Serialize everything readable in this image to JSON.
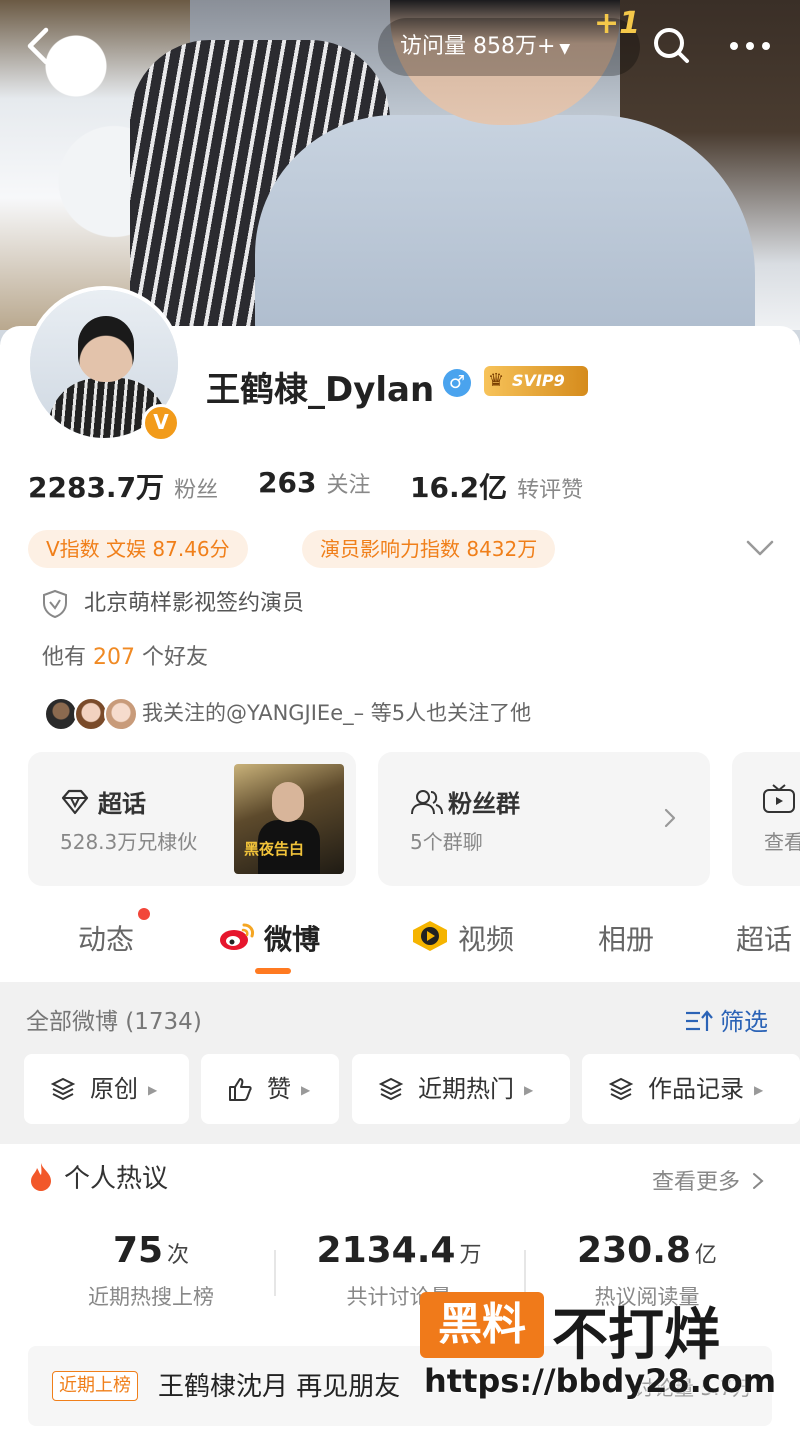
{
  "header": {
    "visits_label": "访问量 858万+",
    "plus_one": "+1"
  },
  "profile": {
    "name": "王鹤棣_Dylan",
    "gender": "♂",
    "svip_label": "SVIP9",
    "verified_badge": "V",
    "stats": [
      {
        "num": "2283.7万",
        "label": "粉丝"
      },
      {
        "num": "263",
        "label": "关注"
      },
      {
        "num": "16.2亿",
        "label": "转评赞"
      }
    ],
    "tags": [
      "V指数 文娱 87.46分",
      "演员影响力指数 8432万"
    ],
    "agency": "北京萌样影视签约演员",
    "friends_prefix": "他有",
    "friends_count": "207",
    "friends_suffix": "个好友",
    "mutual_text": "我关注的@YANGJIEe_– 等5人也关注了他"
  },
  "cards": [
    {
      "title": "超话",
      "sub": "528.3万兄棣伙",
      "icon": "diamond-icon",
      "poster_text": "黑夜告白"
    },
    {
      "title": "粉丝群",
      "sub": "5个群聊",
      "icon": "group-icon"
    },
    {
      "title": "",
      "sub": "查看",
      "icon": "tv-icon"
    }
  ],
  "tabs": [
    "动态",
    "微博",
    "视频",
    "相册",
    "超话"
  ],
  "active_tab": "微博",
  "feed": {
    "heading": "全部微博 (1734)",
    "filter_label": "筛选",
    "chips": [
      "原创",
      "赞",
      "近期热门",
      "作品记录"
    ]
  },
  "hot": {
    "title": "个人热议",
    "see_more": "查看更多",
    "metrics": [
      {
        "value": "75",
        "unit": "次",
        "label": "近期热搜上榜"
      },
      {
        "value": "2134.4",
        "unit": "万",
        "label": "共计讨论量"
      },
      {
        "value": "230.8",
        "unit": "亿",
        "label": "热议阅读量"
      }
    ],
    "trend_badge": "近期上榜",
    "trend_text": "王鹤棣沈月 再见朋友",
    "trend_right": "讨论量 5.7万"
  },
  "watermark": {
    "box_text": "黑料",
    "text": "不打烊",
    "url": "https://bbdy28.com"
  },
  "colors": {
    "accent": "#ff7a21",
    "tag_text": "#f07f1a",
    "link_blue": "#2b63b6",
    "dot_red": "#f2463a"
  }
}
